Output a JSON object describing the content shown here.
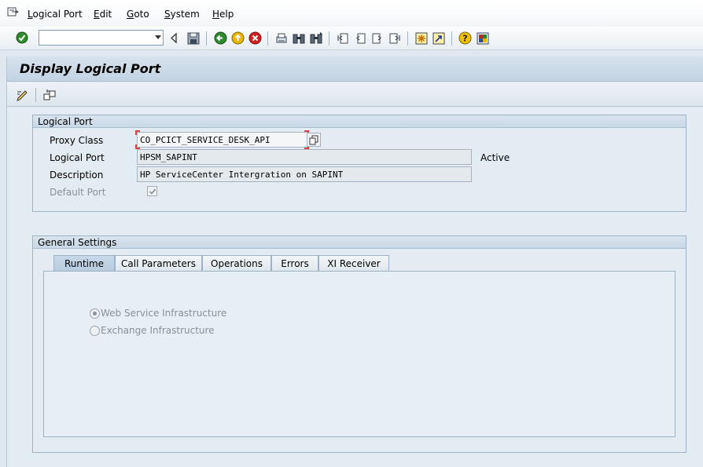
{
  "menu": {
    "items": [
      "Logical Port",
      "Edit",
      "Goto",
      "System",
      "Help"
    ]
  },
  "toolbar": {
    "command_field_value": "",
    "icons": [
      "enter-icon",
      "back-nav-icon",
      "save-icon",
      "back-icon",
      "exit-icon",
      "cancel-icon",
      "print-icon",
      "find-icon",
      "find-next-icon",
      "first-page-icon",
      "previous-page-icon",
      "next-page-icon",
      "last-page-icon",
      "create-session-icon",
      "shortcut-icon",
      "help-icon",
      "layout-icon"
    ]
  },
  "page": {
    "title": "Display Logical Port"
  },
  "app_toolbar": {
    "icons": [
      "display-change-icon",
      "other-object-icon"
    ]
  },
  "logical_port_group": {
    "title": "Logical Port",
    "proxy_class_label": "Proxy Class",
    "proxy_class_value": "CO_PCICT_SERVICE_DESK_API",
    "logical_port_label": "Logical Port",
    "logical_port_value": "HPSM_SAPINT",
    "status": "Active",
    "description_label": "Description",
    "description_value": "HP ServiceCenter Intergration on SAPINT",
    "default_port_label": "Default Port",
    "default_port_checked": true
  },
  "general_settings": {
    "title": "General Settings",
    "tabs": [
      "Runtime",
      "Call Parameters",
      "Operations",
      "Errors",
      "XI Receiver"
    ],
    "active_tab": "Runtime",
    "runtime": {
      "options": [
        "Web Service Infrastructure",
        "Exchange Infrastructure"
      ],
      "selected": "Web Service Infrastructure"
    }
  }
}
